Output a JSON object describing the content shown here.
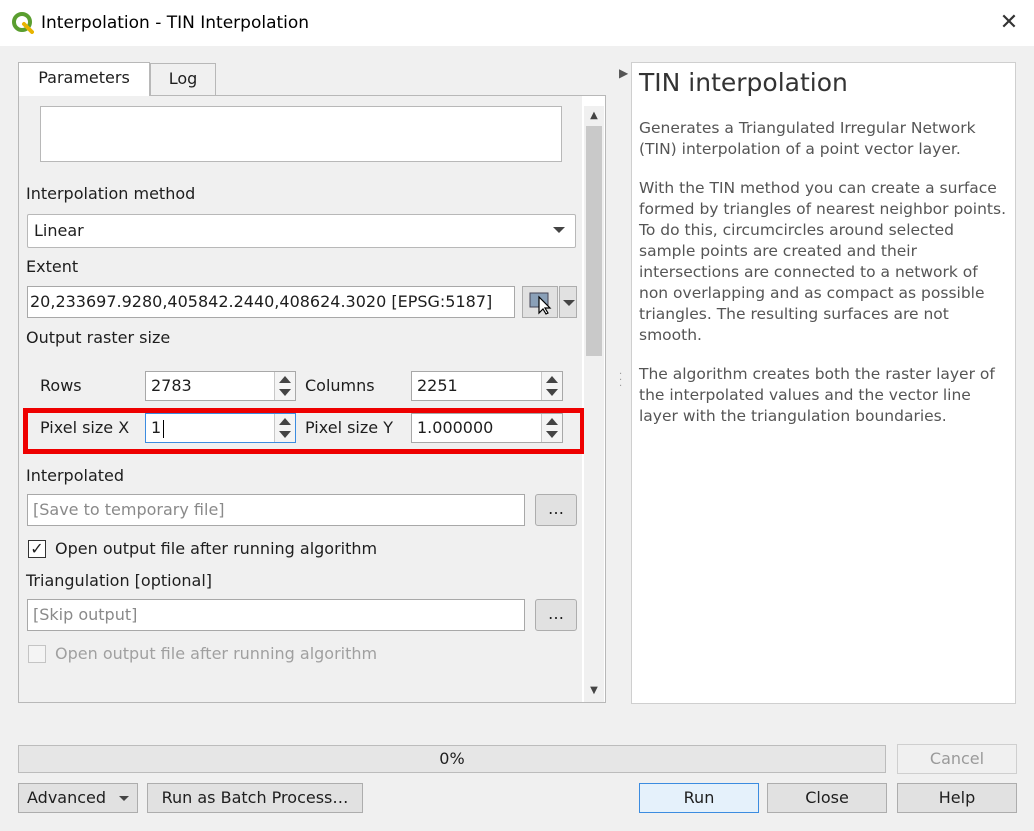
{
  "window": {
    "title": "Interpolation - TIN Interpolation",
    "close_glyph": "✕"
  },
  "tabs": [
    {
      "label": "Parameters",
      "active": true
    },
    {
      "label": "Log",
      "active": false
    }
  ],
  "form": {
    "interpolation_method_label": "Interpolation method",
    "interpolation_method_value": "Linear",
    "extent_label": "Extent",
    "extent_value": "20,233697.9280,405842.2440,408624.3020 [EPSG:5187]",
    "output_raster_size_label": "Output raster size",
    "rows_label": "Rows",
    "rows_value": "2783",
    "columns_label": "Columns",
    "columns_value": "2251",
    "pixel_size_x_label": "Pixel size X",
    "pixel_size_x_value": "1",
    "pixel_size_y_label": "Pixel size Y",
    "pixel_size_y_value": "1.000000",
    "interpolated_label": "Interpolated",
    "interpolated_placeholder": "[Save to temporary file]",
    "browse_label": "…",
    "open_output_1_label": "Open output file after running algorithm",
    "open_output_1_checked": true,
    "triangulation_label": "Triangulation [optional]",
    "triangulation_placeholder": "[Skip output]",
    "open_output_2_label": "Open output file after running algorithm",
    "open_output_2_checked": false
  },
  "help": {
    "title": "TIN interpolation",
    "p1": "Generates a Triangulated Irregular Network (TIN) interpolation of a point vector layer.",
    "p2": "With the TIN method you can create a surface formed by triangles of nearest neighbor points. To do this, circumcircles around selected sample points are created and their intersections are connected to a network of non overlapping and as compact as possible triangles. The resulting surfaces are not smooth.",
    "p3": "The algorithm creates both the raster layer of the interpolated values and the vector line layer with the triangulation boundaries."
  },
  "progress": {
    "text": "0%",
    "value": 0
  },
  "buttons": {
    "cancel": "Cancel",
    "advanced": "Advanced",
    "batch": "Run as Batch Process…",
    "run": "Run",
    "close": "Close",
    "help": "Help"
  },
  "icons": {
    "app": "qgis-logo-icon",
    "extent": "map-canvas-select-icon"
  },
  "colors": {
    "highlight": "#ee0000",
    "qgis_green": "#5a9e2f"
  }
}
